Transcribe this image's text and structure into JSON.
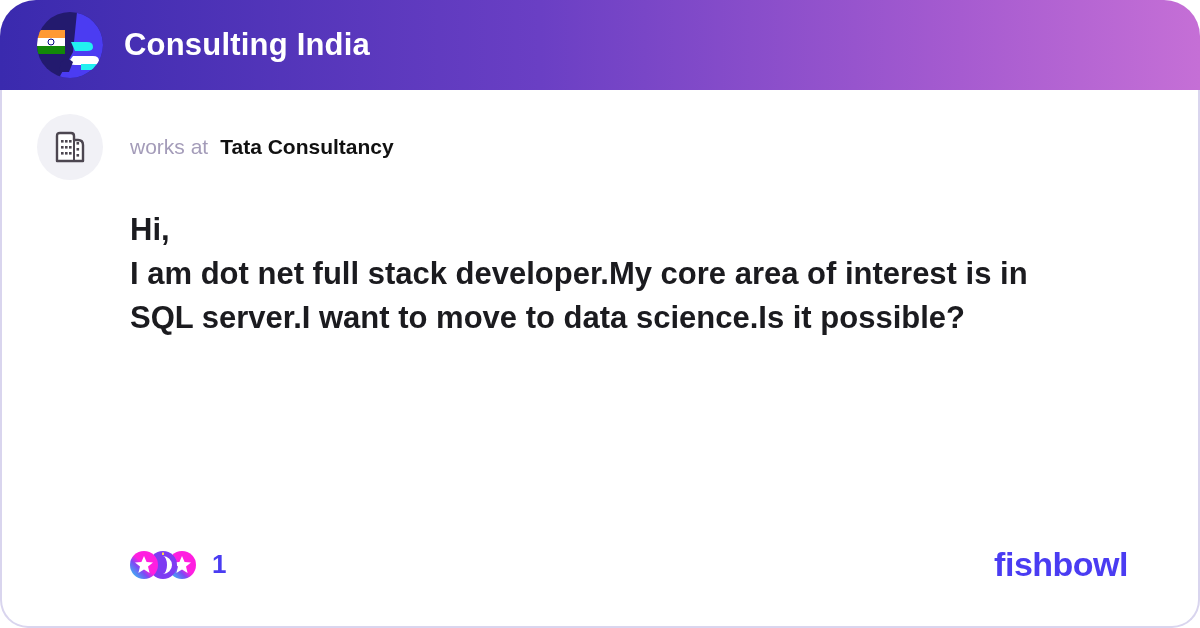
{
  "header": {
    "title": "Consulting India"
  },
  "post": {
    "author": {
      "prefix": "works at",
      "company": "Tata Consultancy"
    },
    "body": "Hi,\nI am dot net full stack developer.My core area of interest is in SQL server.I want to move to data science.Is it possible?",
    "reactions": {
      "count": "1"
    }
  },
  "brand": {
    "logo_text": "fishbowl"
  }
}
